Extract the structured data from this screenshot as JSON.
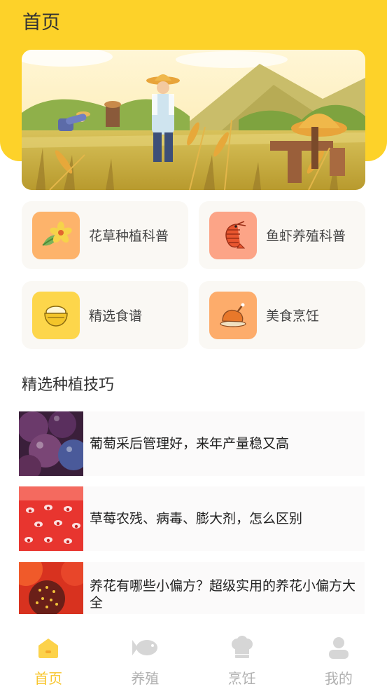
{
  "header": {
    "title": "首页",
    "bg_color": "#fdd229"
  },
  "banner": {
    "name": "farm-harvest-illustration"
  },
  "categories": [
    {
      "label": "花草种植科普",
      "icon": "flower-icon",
      "color": "#fdb36b"
    },
    {
      "label": "鱼虾养殖科普",
      "icon": "shrimp-icon",
      "color": "#fca487"
    },
    {
      "label": "精选食谱",
      "icon": "rice-bowl-icon",
      "color": "#fdd64b"
    },
    {
      "label": "美食烹饪",
      "icon": "roast-chicken-icon",
      "color": "#fdac6b"
    }
  ],
  "section": {
    "title": "精选种植技巧"
  },
  "articles": [
    {
      "title": "葡萄采后管理好，来年产量稳又高",
      "thumb": "grapes-photo"
    },
    {
      "title": "草莓农残、病毒、膨大剂，怎么区别",
      "thumb": "strawberry-photo"
    },
    {
      "title": "养花有哪些小偏方？超级实用的养花小偏方大全",
      "thumb": "flower-photo"
    }
  ],
  "nav": [
    {
      "label": "首页",
      "icon": "home-icon",
      "active": true
    },
    {
      "label": "养殖",
      "icon": "fish-icon",
      "active": false
    },
    {
      "label": "烹饪",
      "icon": "chef-hat-icon",
      "active": false
    },
    {
      "label": "我的",
      "icon": "user-icon",
      "active": false
    }
  ],
  "colors": {
    "accent": "#f8c52b",
    "inactive": "#b0b0b0"
  }
}
